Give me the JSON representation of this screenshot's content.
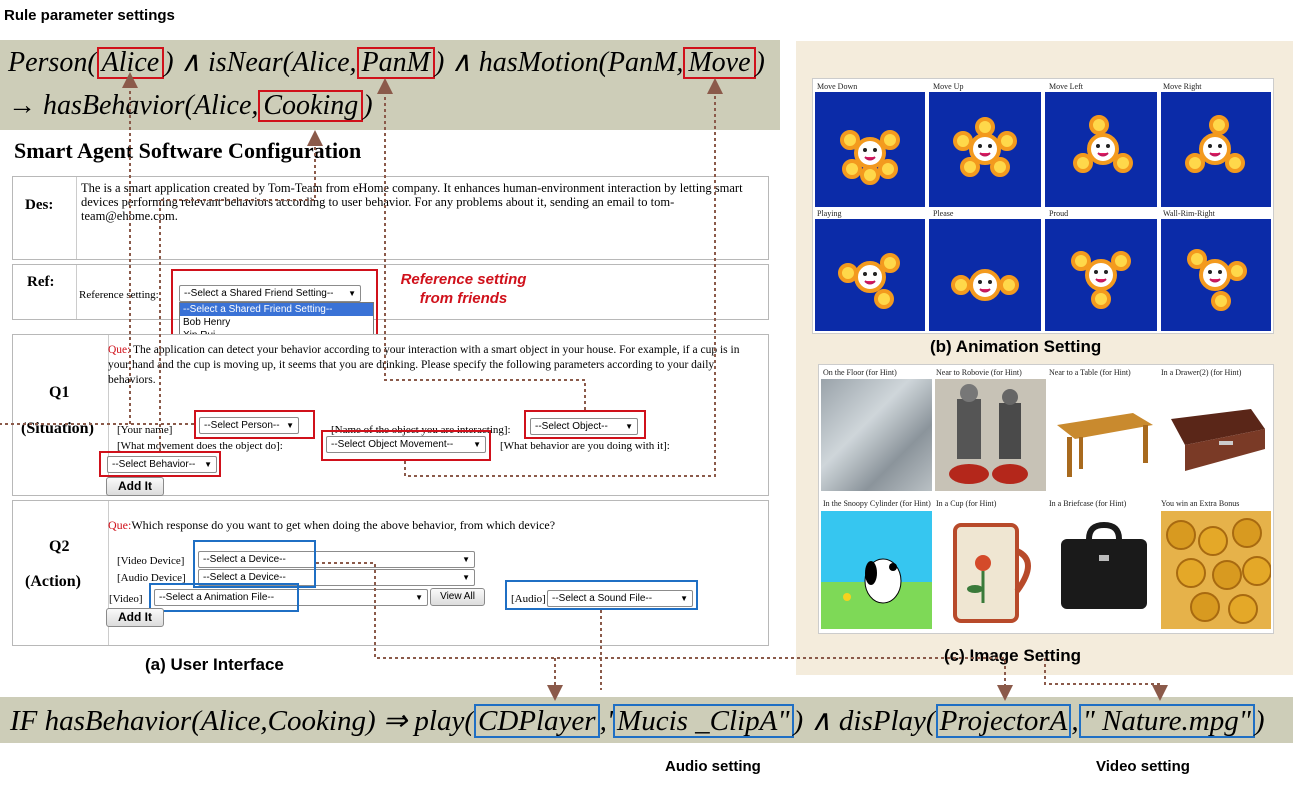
{
  "rule_heading": "Rule parameter settings",
  "rule_formula": {
    "line1": "Person(Alice) ∧ isNear(Alice, PanM) ∧ hasMotion(PanM, Move)",
    "line2": "→ hasBehavior(Alice, Cooking)"
  },
  "ui": {
    "title": "Smart Agent Software Configuration",
    "des_label": "Des:",
    "des_text": "The is a smart application created by Tom-Team from eHome company. It enhances human-environment interaction by letting smart devices performing relevant behaviors according to user behavior. For any problems about it, sending an email to tom-team@ehome.com.",
    "ref_label": "Ref:",
    "ref_setting_label": "Reference setting:",
    "ref_select": "--Select a Shared Friend Setting--",
    "ref_options": [
      "--Select a Shared Friend Setting--",
      "Bob Henry",
      "Xin Rui"
    ],
    "ref_annotation_line1": "Reference setting",
    "ref_annotation_line2": "from friends",
    "q1_label": "Q1",
    "q1_sub": "(Situation)",
    "q1_que": "Que:",
    "q1_text": "The application can detect your behavior according to your interaction with a smart object in your house. For example, if a cup is in your hand and the cup is moving up, it seems that you are drinking. Please specify the following parameters according to your daily behaviors.",
    "your_name_label": "[Your name]",
    "select_person": "--Select Person--",
    "object_label": "[Name of the object you are interacting]:",
    "select_object": "--Select Object--",
    "movement_label": "[What movement does the object do]:",
    "select_movement": "--Select Object Movement--",
    "behavior_label": "[What behavior are you doing with it]:",
    "select_behavior": "--Select Behavior--",
    "add_it": "Add It",
    "q2_label": "Q2",
    "q2_sub": "(Action)",
    "q2_que": "Que:",
    "q2_text": "Which response do you want to get when doing the above behavior, from which device?",
    "video_device_label": "[Video Device]",
    "select_device_1": "--Select a Device--",
    "audio_device_label": "[Audio Device]",
    "select_device_2": "--Select a Device--",
    "video_label": "[Video]",
    "select_animation": "--Select a Animation File--",
    "view_all": "View All",
    "audio_label": "[Audio]",
    "select_sound": "--Select a Sound File--",
    "add_it_2": "Add It",
    "caption": "(a) User Interface"
  },
  "animation": {
    "tiles": [
      "Move Down",
      "Move Up",
      "Move Left",
      "Move Right",
      "Playing",
      "Please",
      "Proud",
      "Wall-Rim-Right"
    ],
    "caption": "(b) Animation Setting"
  },
  "images": {
    "tiles": [
      "On the Floor (for Hint)",
      "Near to Robovie (for Hint)",
      "Near to a Table (for Hint)",
      "In a Drawer(2) (for Hint)",
      "In the Snoopy Cylinder (for Hint)",
      "In a Cup (for Hint)",
      "In a Briefcase (for Hint)",
      "You win an Extra Bonus"
    ],
    "caption": "(c) Image Setting"
  },
  "action_formula": "IF hasBehavior(Alice,Cooking) ⇒ play(CDPlayer,' Mucis _ClipA\") ∧ disPlay(ProjectorA,\" Nature.mpg\")",
  "bottom_labels": {
    "audio": "Audio setting",
    "video": "Video setting"
  },
  "colors": {
    "red_box": "#d0111b",
    "blue_box": "#1f6fc4",
    "arrow": "#8b5a4a",
    "formula_bg": "#cdcdb8",
    "right_panel_bg": "#f4ecdc",
    "tile_blue": "#0b2ba8"
  }
}
